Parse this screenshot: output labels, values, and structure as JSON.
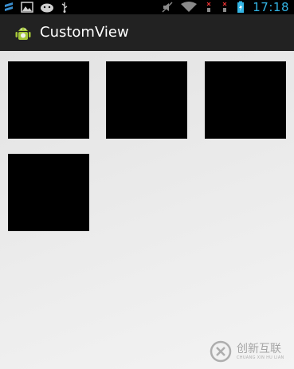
{
  "status_bar": {
    "time": "17:18",
    "left_icons": [
      "notification-icon",
      "image-icon",
      "android-debug-icon",
      "usb-icon"
    ],
    "right_icons": [
      "mute-icon",
      "wifi-icon",
      "signal-no-sim-icon",
      "signal-no-sim-icon",
      "battery-charging-icon"
    ],
    "time_color": "#33b5e5"
  },
  "action_bar": {
    "app_icon": "android-app-icon",
    "title": "CustomView"
  },
  "content": {
    "tiles": [
      {
        "color": "#000000"
      },
      {
        "color": "#000000"
      },
      {
        "color": "#000000"
      },
      {
        "color": "#000000"
      }
    ]
  },
  "watermark": {
    "text_cn": "创新互联",
    "text_en": "CHUANG XIN HU LIAN"
  }
}
